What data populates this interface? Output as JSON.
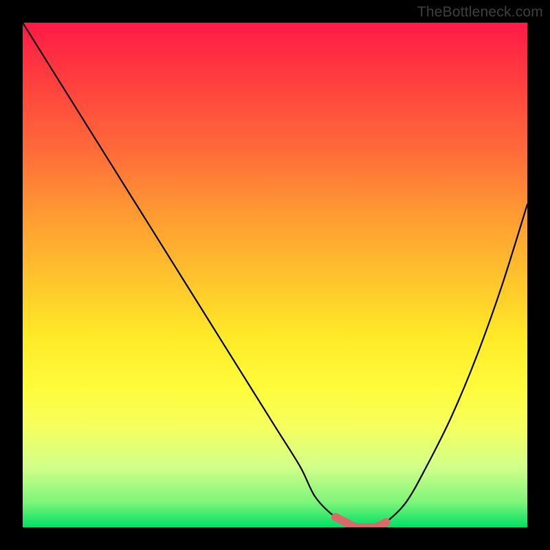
{
  "watermark": "TheBottleneck.com",
  "chart_data": {
    "type": "line",
    "title": "",
    "xlabel": "",
    "ylabel": "",
    "xlim": [
      0,
      100
    ],
    "ylim": [
      0,
      100
    ],
    "grid": false,
    "series": [
      {
        "name": "bottleneck-curve",
        "x": [
          0,
          5,
          10,
          15,
          20,
          25,
          30,
          35,
          40,
          45,
          50,
          55,
          58,
          62,
          66,
          70,
          72,
          76,
          80,
          85,
          90,
          95,
          100
        ],
        "values": [
          100,
          92,
          84,
          76,
          68,
          60,
          52,
          44,
          36,
          28,
          20,
          12,
          6,
          2,
          0,
          0,
          1,
          5,
          12,
          22,
          34,
          48,
          64
        ],
        "color": "#000000"
      },
      {
        "name": "sweet-spot",
        "x": [
          62,
          64,
          66,
          68,
          70,
          72
        ],
        "values": [
          2,
          1,
          0,
          0,
          0,
          1
        ],
        "color": "#d86a6a"
      }
    ],
    "gradient": {
      "stops": [
        {
          "pos": 0,
          "color": "#ff1a47"
        },
        {
          "pos": 10,
          "color": "#ff3a3f"
        },
        {
          "pos": 25,
          "color": "#ff6a3a"
        },
        {
          "pos": 38,
          "color": "#ff9a32"
        },
        {
          "pos": 52,
          "color": "#ffc82c"
        },
        {
          "pos": 62,
          "color": "#ffe928"
        },
        {
          "pos": 72,
          "color": "#fffb3a"
        },
        {
          "pos": 80,
          "color": "#f6ff5e"
        },
        {
          "pos": 88,
          "color": "#d2ff8a"
        },
        {
          "pos": 95,
          "color": "#7ef47a"
        },
        {
          "pos": 100,
          "color": "#00e064"
        }
      ]
    }
  }
}
